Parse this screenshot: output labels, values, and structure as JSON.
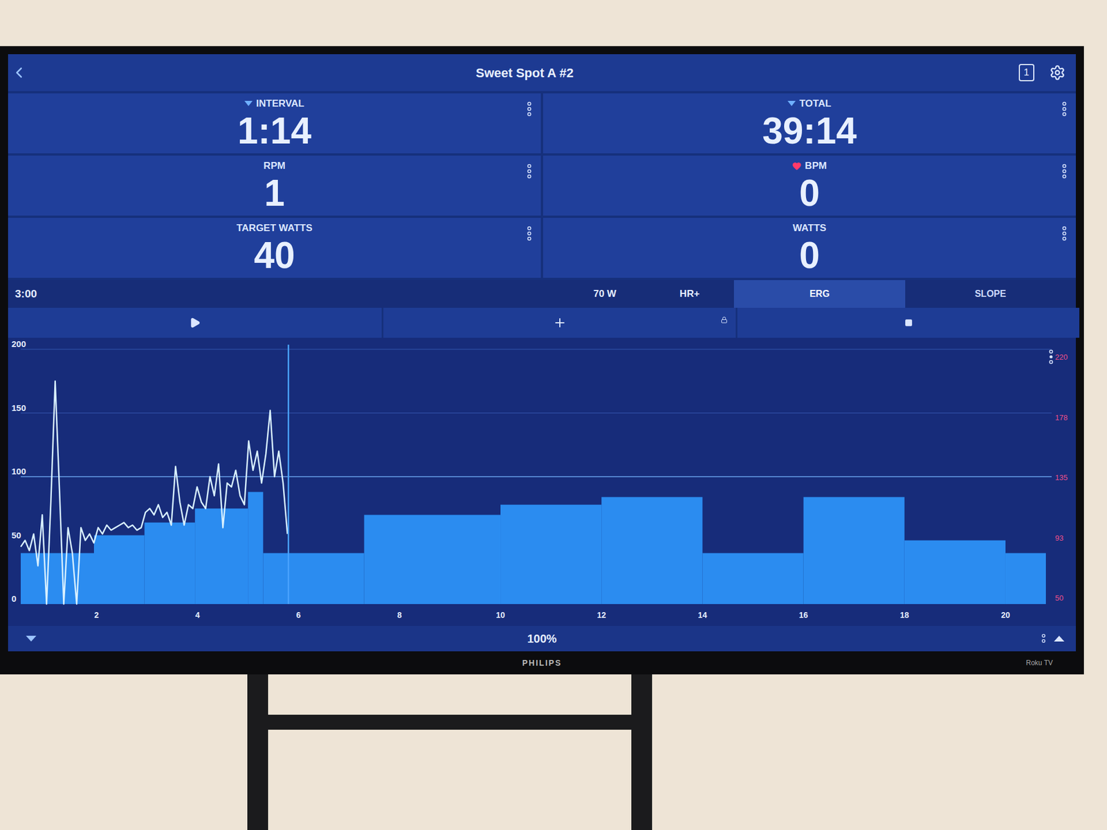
{
  "tv": {
    "brand": "PHILIPS",
    "badge": "Roku TV"
  },
  "header": {
    "title": "Sweet Spot A #2",
    "badge": "1"
  },
  "metrics": [
    {
      "label": "INTERVAL",
      "value": "1:14",
      "kind": "dropdown"
    },
    {
      "label": "TOTAL",
      "value": "39:14",
      "kind": "dropdown"
    },
    {
      "label": "RPM",
      "value": "1",
      "kind": "plain"
    },
    {
      "label": "BPM",
      "value": "0",
      "kind": "heart"
    },
    {
      "label": "TARGET WATTS",
      "value": "40",
      "kind": "plain"
    },
    {
      "label": "WATTS",
      "value": "0",
      "kind": "plain"
    }
  ],
  "mode_bar": {
    "time": "3:00",
    "items": [
      "70 W",
      "HR+"
    ],
    "modes": [
      {
        "label": "ERG",
        "selected": true
      },
      {
        "label": "SLOPE",
        "selected": false
      }
    ]
  },
  "controls": {
    "locked": true
  },
  "chart": {
    "y_ticks": [
      "0",
      "50",
      "100",
      "150",
      "200"
    ],
    "hr_ticks": [
      "220",
      "178",
      "135",
      "93",
      "50"
    ],
    "x_ticks": [
      "2",
      "4",
      "6",
      "8",
      "10",
      "12",
      "14",
      "16",
      "18",
      "20"
    ],
    "ftp_watts": 100,
    "cursor_minute": 5.8,
    "intervals": [
      {
        "start": 0.5,
        "end": 1.95,
        "watts": 40
      },
      {
        "start": 1.95,
        "end": 2.95,
        "watts": 54
      },
      {
        "start": 2.95,
        "end": 3.95,
        "watts": 64
      },
      {
        "start": 3.95,
        "end": 5.0,
        "watts": 75
      },
      {
        "start": 5.0,
        "end": 5.3,
        "watts": 88
      },
      {
        "start": 5.3,
        "end": 7.3,
        "watts": 40
      },
      {
        "start": 7.3,
        "end": 10,
        "watts": 70
      },
      {
        "start": 10,
        "end": 12,
        "watts": 78
      },
      {
        "start": 12,
        "end": 14,
        "watts": 84
      },
      {
        "start": 14,
        "end": 16,
        "watts": 40
      },
      {
        "start": 16,
        "end": 18,
        "watts": 84
      },
      {
        "start": 18,
        "end": 20,
        "watts": 50
      },
      {
        "start": 20,
        "end": 20.8,
        "watts": 40
      }
    ],
    "power": {
      "start_minute": 0.5,
      "end_minute": 5.78,
      "values": [
        45,
        50,
        42,
        55,
        30,
        70,
        0,
        80,
        175,
        90,
        0,
        60,
        40,
        0,
        60,
        50,
        55,
        48,
        60,
        55,
        62,
        58,
        60,
        62,
        64,
        60,
        62,
        58,
        60,
        72,
        75,
        70,
        78,
        68,
        72,
        62,
        108,
        80,
        62,
        78,
        75,
        92,
        80,
        75,
        100,
        85,
        110,
        60,
        95,
        92,
        105,
        85,
        78,
        128,
        105,
        120,
        95,
        118,
        152,
        100,
        120,
        95,
        55
      ]
    }
  },
  "footer": {
    "intensity": "100%"
  }
}
